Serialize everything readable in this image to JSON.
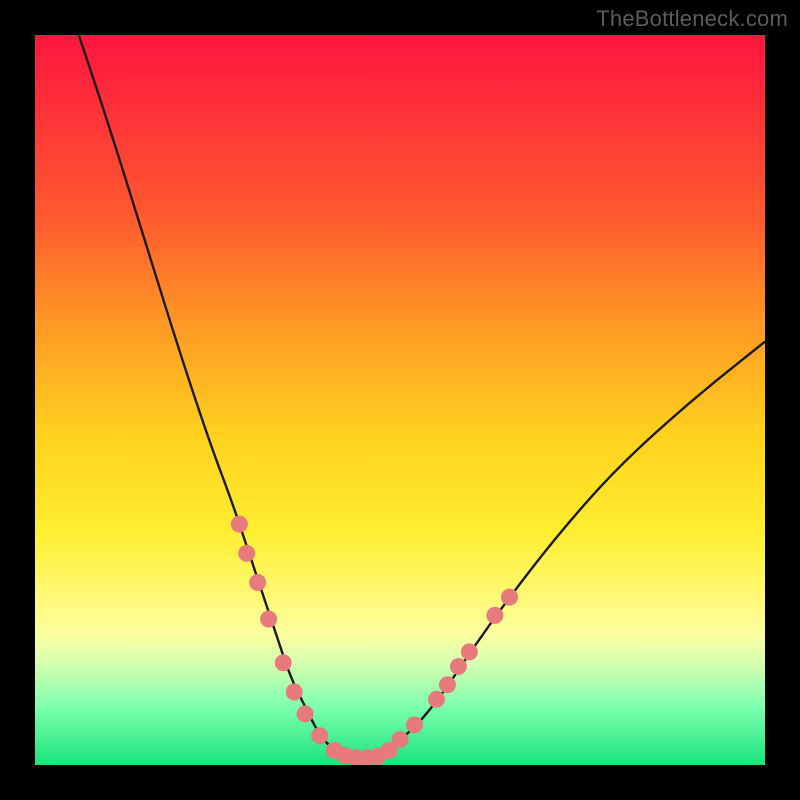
{
  "watermark": "TheBottleneck.com",
  "colors": {
    "curve_stroke": "#1a1a1a",
    "marker_fill": "#e77a7a",
    "marker_stroke": "#d86a6a",
    "frame_bg": "#000000",
    "gradient_top": "#ff153f",
    "gradient_bottom": "#19e37a"
  },
  "chart_data": {
    "type": "line",
    "title": "",
    "xlabel": "",
    "ylabel": "",
    "xlim": [
      0,
      100
    ],
    "ylim": [
      0,
      100
    ],
    "series": [
      {
        "name": "bottleneck-curve",
        "x": [
          6,
          10,
          15,
          20,
          24,
          27,
          29,
          31,
          33,
          35,
          37,
          39,
          41,
          43,
          45,
          48,
          52,
          56,
          60,
          65,
          72,
          80,
          90,
          100
        ],
        "values": [
          100,
          88,
          72,
          56,
          44,
          36,
          30,
          24,
          18,
          12,
          8,
          4,
          2,
          1,
          1,
          2,
          5,
          10,
          16,
          23,
          32,
          41,
          50,
          58
        ]
      }
    ],
    "markers": [
      {
        "x": 28,
        "y": 33
      },
      {
        "x": 29,
        "y": 29
      },
      {
        "x": 30.5,
        "y": 25
      },
      {
        "x": 32,
        "y": 20
      },
      {
        "x": 34,
        "y": 14
      },
      {
        "x": 35.5,
        "y": 10
      },
      {
        "x": 37,
        "y": 7
      },
      {
        "x": 39,
        "y": 4
      },
      {
        "x": 41,
        "y": 2
      },
      {
        "x": 42.5,
        "y": 1.3
      },
      {
        "x": 44,
        "y": 1
      },
      {
        "x": 45.5,
        "y": 1
      },
      {
        "x": 47,
        "y": 1.2
      },
      {
        "x": 48.5,
        "y": 2
      },
      {
        "x": 50,
        "y": 3.5
      },
      {
        "x": 52,
        "y": 5.5
      },
      {
        "x": 55,
        "y": 9
      },
      {
        "x": 56.5,
        "y": 11
      },
      {
        "x": 58,
        "y": 13.5
      },
      {
        "x": 59.5,
        "y": 15.5
      },
      {
        "x": 63,
        "y": 20.5
      },
      {
        "x": 65,
        "y": 23
      }
    ]
  }
}
